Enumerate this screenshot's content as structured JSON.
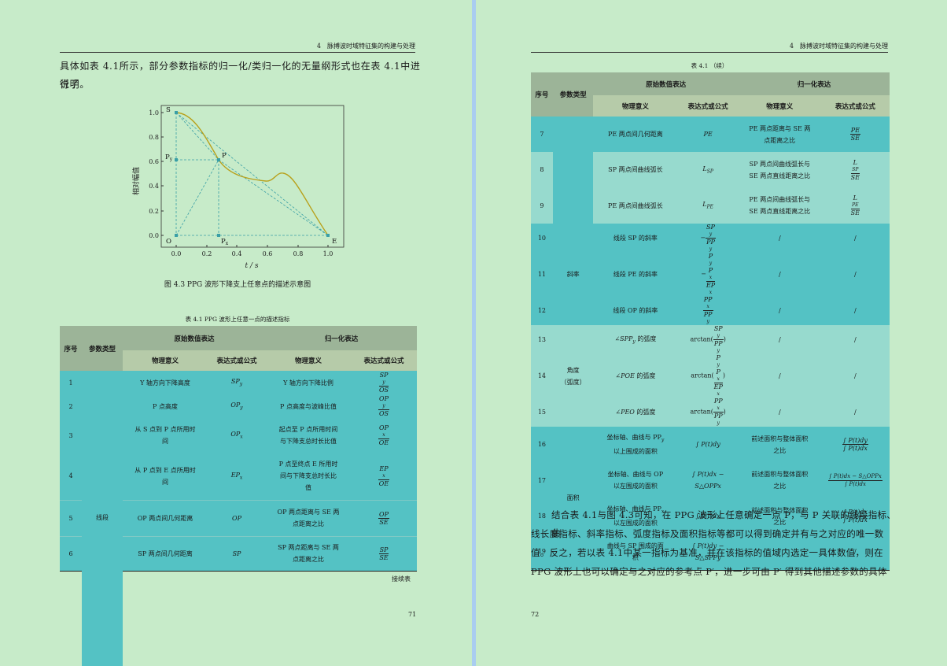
{
  "left": {
    "header": "4　脉搏波时域特征集的构建与处理",
    "para1_line1": "具体如表 4.1所示，部分参数指标的归一化/类归一化的无量纲形式也在表 4.1中进行了",
    "para1_line2": "说明。",
    "figure": {
      "ylabel": "相对幅值",
      "xlabel": "t / s",
      "yticks": [
        "0.0",
        "0.2",
        "0.4",
        "0.6",
        "0.8",
        "1.0"
      ],
      "xticks": [
        "0.0",
        "0.2",
        "0.4",
        "0.6",
        "0.8",
        "1.0"
      ],
      "points": {
        "S": "S",
        "P": "P",
        "Py": "P",
        "Py_sub": "y",
        "Px": "P",
        "Px_sub": "x",
        "O": "O",
        "E": "E"
      },
      "caption": "图 4.3  PPG 波形下降支上任意点的描述示意图"
    },
    "table_title": "表 4.1 PPG 波形上任意一点的描述指标",
    "table_header": {
      "seq": "序号",
      "type": "参数类型",
      "orig": "原始数值表达",
      "norm": "归一化表达",
      "meaning": "物理意义",
      "formula": "表达式或公式"
    },
    "rows": [
      {
        "no": "1",
        "m1": "Y 轴方向下降高度",
        "f1": "SP",
        "f1s": "y",
        "m2": "Y 轴方向下降比例",
        "n": "SP",
        "ns": "y",
        "d": "OS",
        "ds": ""
      },
      {
        "no": "2",
        "m1": "P 点高度",
        "f1": "OP",
        "f1s": "y",
        "m2": "P 点高度与波峰比值",
        "n": "OP",
        "ns": "y",
        "d": "OS",
        "ds": ""
      },
      {
        "no": "3",
        "m1a": "从 S 点到 P 点所用时",
        "m1b": "间",
        "f1": "OP",
        "f1s": "x",
        "m2a": "起点至 P 点所用时间",
        "m2b": "与下降支总时长比值",
        "n": "OP",
        "ns": "x",
        "d": "OE",
        "ds": ""
      },
      {
        "no": "4",
        "m1a": "从 P 点到 E 点所用时",
        "m1b": "间",
        "f1": "EP",
        "f1s": "x",
        "m2a": "P 点至终点 E 所用时",
        "m2b": "间与下降支总时长比",
        "m2c": "值",
        "n": "EP",
        "ns": "x",
        "d": "OE",
        "ds": ""
      },
      {
        "no": "5",
        "type": "线段",
        "m1": "OP 两点间几何距离",
        "f1": "OP",
        "m2a": "OP 两点距离与 SE 两",
        "m2b": "点距离之比",
        "n": "OP",
        "d": "SE"
      },
      {
        "no": "6",
        "m1": "SP 两点间几何距离",
        "f1": "SP",
        "m2a": "SP 两点距离与 SE 两",
        "m2b": "点距离之比",
        "n": "SP",
        "d": "SE"
      }
    ],
    "continue_label": "接续表",
    "page_number": "71"
  },
  "right": {
    "header": "4　脉搏波时域特征集的构建与处理",
    "table_title": "表 4.1 （续）",
    "rows": [
      {
        "no": "7",
        "m1": "PE 两点间几何距离",
        "f1": "PE",
        "m2a": "PE 两点距离与 SE 两",
        "m2b": "点距离之比",
        "n": "PE",
        "d": "SE"
      },
      {
        "no": "8",
        "m1": "SP 两点间曲线弧长",
        "f1": "L",
        "f1s": "SP",
        "m2a": "SP 两点间曲线弧长与",
        "m2b": "SE 两点直线距离之比",
        "n": "L",
        "ns": "SP",
        "d": "SE"
      },
      {
        "no": "9",
        "m1": "PE 两点间曲线弧长",
        "f1": "L",
        "f1s": "PE",
        "m2a": "PE 两点间曲线弧长与",
        "m2b": "SE 两点直线距离之比",
        "n": "L",
        "ns": "PE",
        "d": "SE"
      },
      {
        "no": "10",
        "m1": "线段 SP 的斜率",
        "f1pre": "−",
        "n": "SP",
        "ns": "y",
        "d": "PP",
        "ds": "y",
        "m2": "/",
        "f2": "/"
      },
      {
        "no": "11",
        "type": "斜率",
        "m1": "线段 PE 的斜率",
        "f1pre": "−",
        "n": "P",
        "ns": "y",
        "n2": "P",
        "n2s": "x",
        "d": "EP",
        "ds": "x",
        "m2": "/",
        "f2": "/"
      },
      {
        "no": "12",
        "m1": "线段 OP 的斜率",
        "n": "PP",
        "ns": "x",
        "d": "PP",
        "ds": "y",
        "m2": "/",
        "f2": "/"
      },
      {
        "no": "13",
        "m1": "∠SPP",
        "m1s": "y",
        "m1t": " 的弧度",
        "fpre": "arctan(",
        "n": "SP",
        "ns": "y",
        "d": "PP",
        "ds": "y",
        "m2": "/",
        "f2": "/"
      },
      {
        "no": "14",
        "typea": "角度",
        "typeb": "（弧度）",
        "m1": "∠POE",
        "m1t": " 的弧度",
        "fpre": "arctan(",
        "n": "P",
        "ns": "y",
        "n2": "P",
        "n2s": "x",
        "d": "EP",
        "ds": "x",
        "m2": "/",
        "f2": "/"
      },
      {
        "no": "15",
        "m1": "∠PEO",
        "m1t": " 的弧度",
        "fpre": "arctan(",
        "n": "PP",
        "ns": "x",
        "d": "PP",
        "ds": "y",
        "m2": "/",
        "f2": "/"
      },
      {
        "no": "16",
        "m1a": "坐标轴、曲线与 PP",
        "m1as": "y",
        "m1b": "以上围成的面积",
        "f1": "∫ P(t)dy",
        "m2a": "前述面积与整体面积",
        "m2b": "之比",
        "n": "∫ P(t)dy",
        "d": "∫ P(t)dx"
      },
      {
        "no": "17",
        "m1a": "坐标轴、曲线与 OP",
        "m1b": "以左围成的面积",
        "f1a": "∫ P(t)dx −",
        "f1b": "S△OPPx",
        "m2a": "前述面积与整体面积",
        "m2b": "之比",
        "n": "∫ P(t)dx − S△OPPx",
        "d": "∫ P(t)dx"
      },
      {
        "no": "18",
        "type": "面积",
        "m1a": "坐标轴、曲线与 PP",
        "m1as": "x",
        "m1b": "以左围成的面积",
        "f1": "∫ P(t)dx",
        "m2a": "前述面积与整体面积",
        "m2b": "之比",
        "n": "∫ P(t)dx",
        "d": "∫ P(t)dx"
      },
      {
        "no": "19",
        "m1a": "曲线与 SP 围成的面",
        "m1b": "积",
        "f1a": "∫ P(t)dy −",
        "f1b": "S△SPPy",
        "m2": "/",
        "f2": "/"
      }
    ],
    "para_lines": [
      "结合表 4.1与图 4.3可知，在 PPG 波形上任意确定一点 P，与 P 关联的线段指标、曲",
      "线长度指标、斜率指标、弧度指标及面积指标等都可以得到确定并有与之对应的唯一数",
      "值。反之，若以表 4.1中某一指标为基准，并在该指标的值域内选定一具体数值，则在",
      "PPG 波形上也可以确定与之对应的参考点 P′，进一步可由 P′ 得到其他描述参数的具体"
    ],
    "page_number": "72"
  }
}
